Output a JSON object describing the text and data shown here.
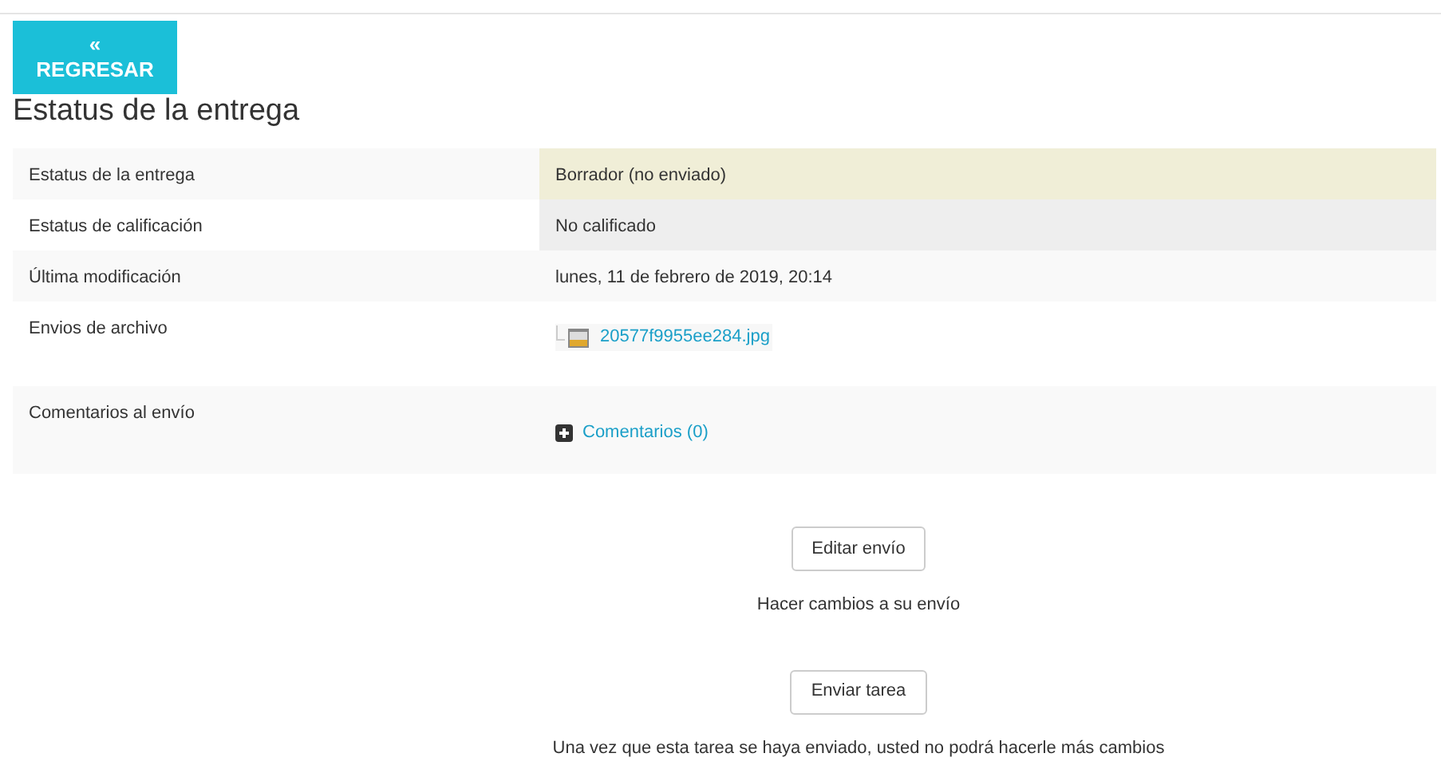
{
  "back_button": {
    "icon": "«",
    "label": "REGRESAR"
  },
  "heading": "Estatus de la entrega",
  "rows": [
    {
      "kind": "text",
      "label": "Estatus de la entrega",
      "value": "Borrador (no enviado)",
      "color": "#f0eed7"
    },
    {
      "kind": "text",
      "label": "Estatus de calificación",
      "value": "No calificado",
      "color": "#eeeeee"
    },
    {
      "kind": "text",
      "label": "Última modificación",
      "value": "lunes, 11 de febrero de 2019, 20:14"
    },
    {
      "kind": "file",
      "label": "Envios de archivo",
      "value": "20577f9955ee284.jpg"
    },
    {
      "kind": "comments",
      "label": "Comentarios al envío",
      "value": "Comentarios (0)"
    }
  ],
  "actions": [
    {
      "button": "Editar envío",
      "description": "Hacer cambios a su envío"
    },
    {
      "button": "Enviar tarea",
      "description": "Una vez que esta tarea se haya enviado, usted no podrá hacerle más cambios"
    }
  ]
}
